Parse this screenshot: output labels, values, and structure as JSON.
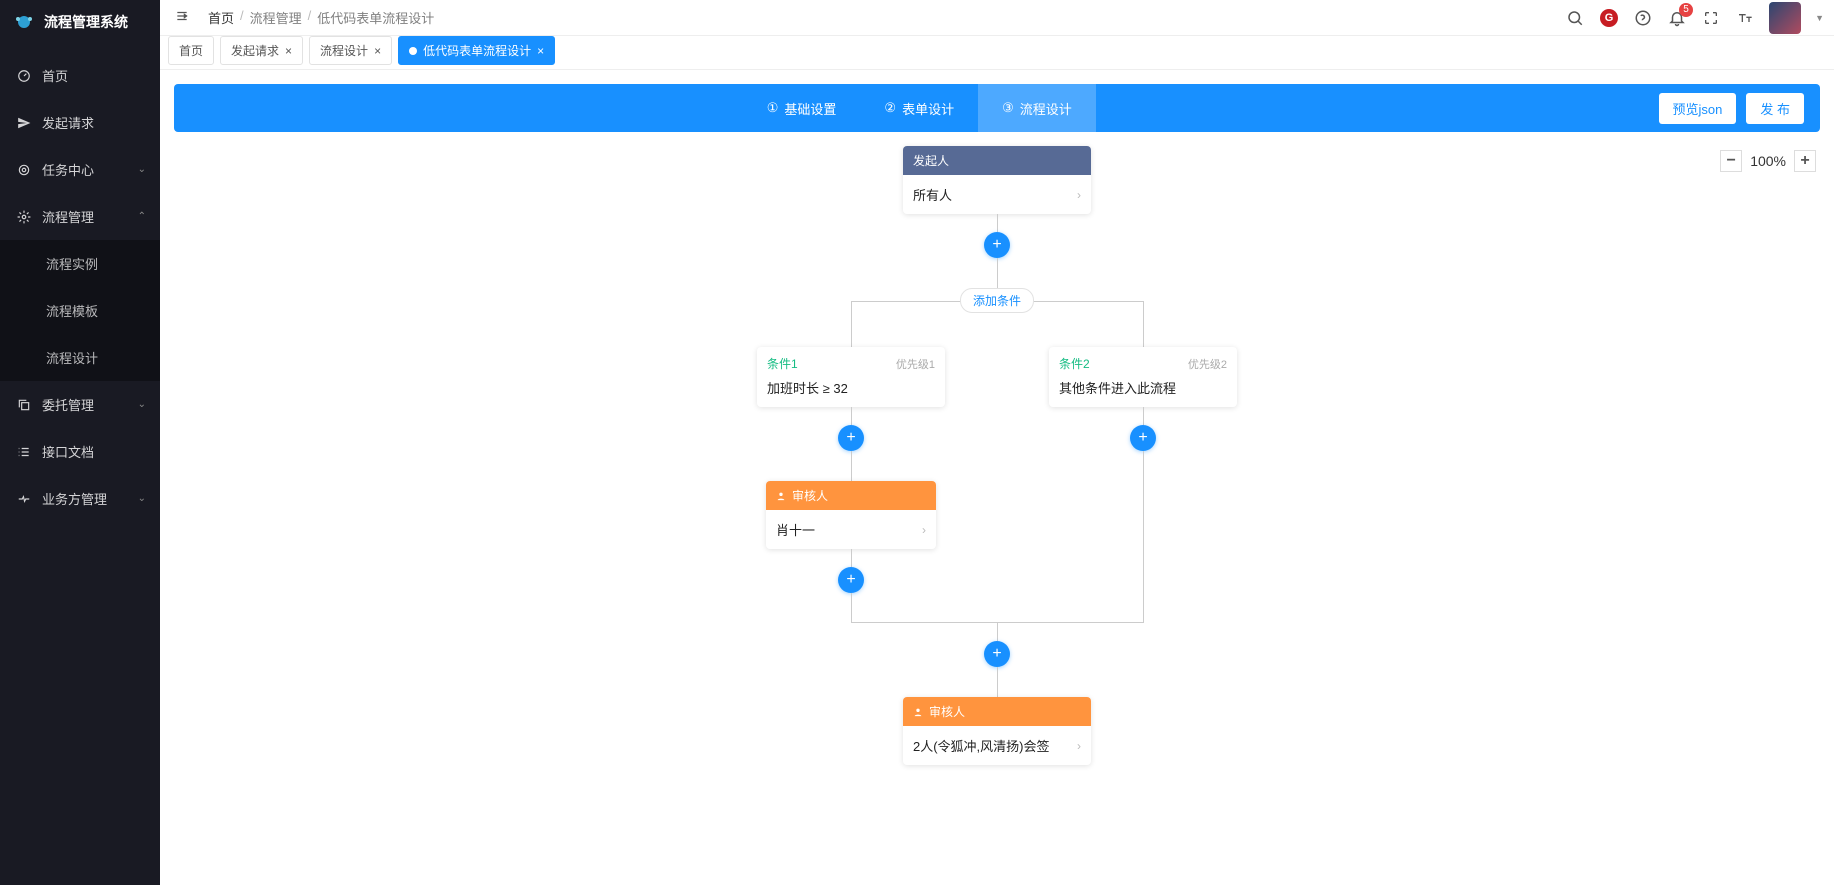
{
  "app_name": "流程管理系统",
  "sidebar": {
    "items": [
      {
        "label": "首页"
      },
      {
        "label": "发起请求"
      },
      {
        "label": "任务中心"
      },
      {
        "label": "流程管理"
      },
      {
        "label": "流程实例"
      },
      {
        "label": "流程模板"
      },
      {
        "label": "流程设计"
      },
      {
        "label": "委托管理"
      },
      {
        "label": "接口文档"
      },
      {
        "label": "业务方管理"
      }
    ]
  },
  "breadcrumb": [
    "首页",
    "流程管理",
    "低代码表单流程设计"
  ],
  "notif_count": "5",
  "tabs": [
    {
      "label": "首页"
    },
    {
      "label": "发起请求"
    },
    {
      "label": "流程设计"
    },
    {
      "label": "低代码表单流程设计"
    }
  ],
  "steps": [
    {
      "num": "①",
      "label": "基础设置"
    },
    {
      "num": "②",
      "label": "表单设计"
    },
    {
      "num": "③",
      "label": "流程设计"
    }
  ],
  "toolbar": {
    "preview": "预览json",
    "publish": "发 布"
  },
  "zoom": "100%",
  "flow": {
    "start": {
      "title": "发起人",
      "body": "所有人"
    },
    "add_condition": "添加条件",
    "cond1": {
      "name": "条件1",
      "priority": "优先级1",
      "body": "加班时长 ≥ 32"
    },
    "cond2": {
      "name": "条件2",
      "priority": "优先级2",
      "body": "其他条件进入此流程"
    },
    "approver1": {
      "title": "审核人",
      "body": "肖十一"
    },
    "approver2": {
      "title": "审核人",
      "body": "2人(令狐冲,风清扬)会签"
    }
  }
}
